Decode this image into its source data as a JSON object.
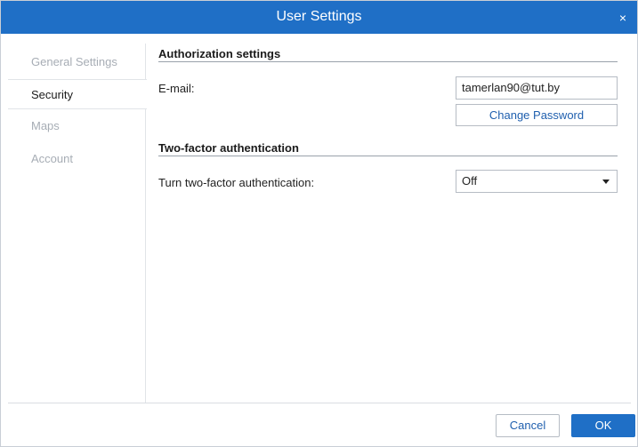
{
  "dialog": {
    "title": "User Settings",
    "close_glyph": "×"
  },
  "sidebar": {
    "items": [
      {
        "label": "General Settings",
        "active": false
      },
      {
        "label": "Security",
        "active": true
      },
      {
        "label": "Maps",
        "active": false
      },
      {
        "label": "Account",
        "active": false
      }
    ]
  },
  "authorization": {
    "section_title": "Authorization settings",
    "email_label": "E-mail:",
    "email_value": "tamerlan90@tut.by",
    "change_password_label": "Change Password"
  },
  "two_factor": {
    "section_title": "Two-factor authentication",
    "toggle_label": "Turn two-factor authentication:",
    "selected_value": "Off"
  },
  "footer": {
    "cancel_label": "Cancel",
    "ok_label": "OK"
  },
  "colors": {
    "titlebar": "#1f6fc6",
    "link_text": "#1f5fae",
    "inactive_nav": "#a7adb5"
  },
  "icons": {
    "close": "close-icon",
    "dropdown": "chevron-down-icon"
  }
}
